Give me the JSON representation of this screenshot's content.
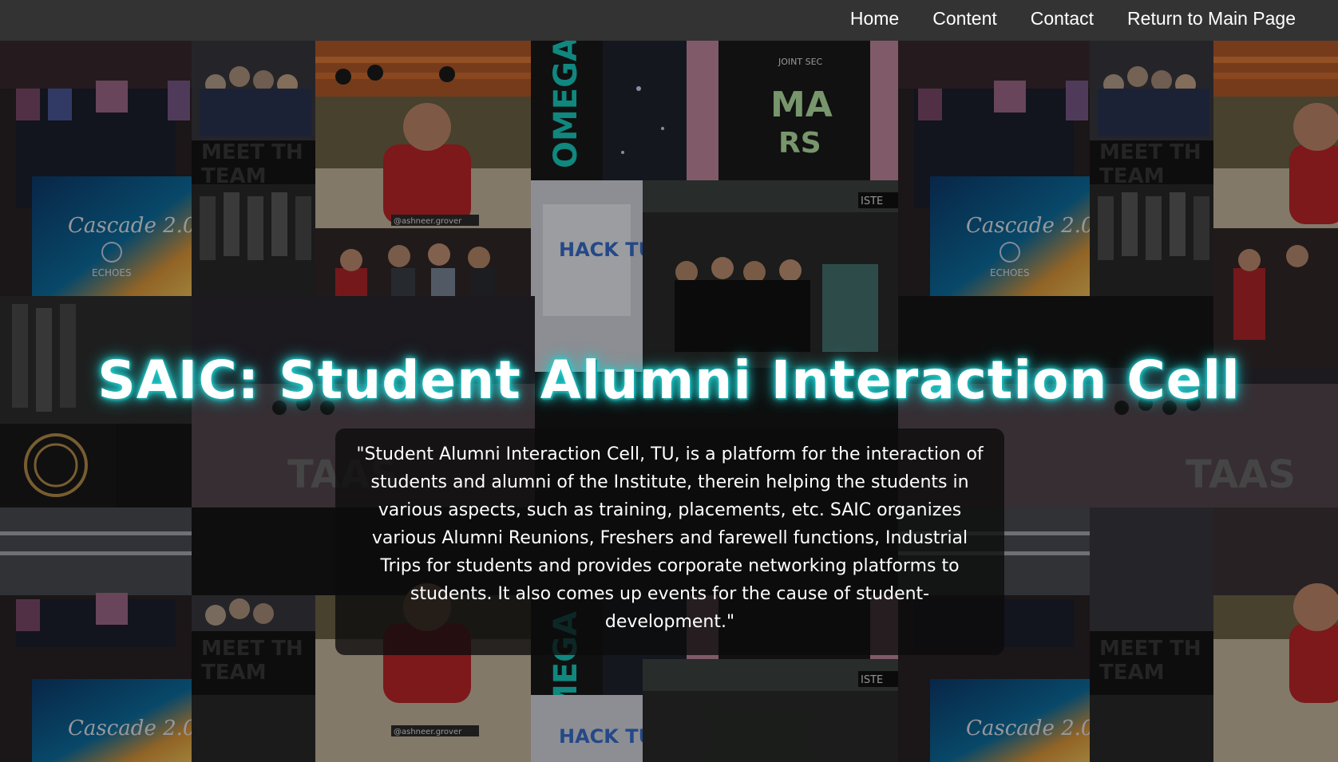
{
  "nav": {
    "links": [
      {
        "label": "Home"
      },
      {
        "label": "Content"
      },
      {
        "label": "Contact"
      },
      {
        "label": "Return to Main Page"
      }
    ]
  },
  "hero": {
    "title": "SAIC: Student Alumni Interaction Cell",
    "description": "\"Student Alumni Interaction Cell, TU, is a platform for the interaction of students and alumni of the Institute, therein helping the students in various aspects, such as training, placements, etc. SAIC organizes various Alumni Reunions, Freshers and farewell functions, Industrial Trips for students and provides corporate networking platforms to students. It also comes up events for the cause of student-development.\""
  },
  "collage": {
    "texts": {
      "meet_the_team": "MEET TH\nTEAM",
      "cascade": "Cascade 2.0",
      "echoes": "ECHOES",
      "omega": "OMEGA",
      "hack": "HACK TU",
      "joint_sec": "JOINT SEC",
      "handle": "@ashneer.grover",
      "iste": "ISTE",
      "taas": "TAAS"
    },
    "colors": {
      "accent_glow": "#2ad6d6",
      "nav_bg": "#333333",
      "box_bg": "#0c0c0c"
    }
  }
}
